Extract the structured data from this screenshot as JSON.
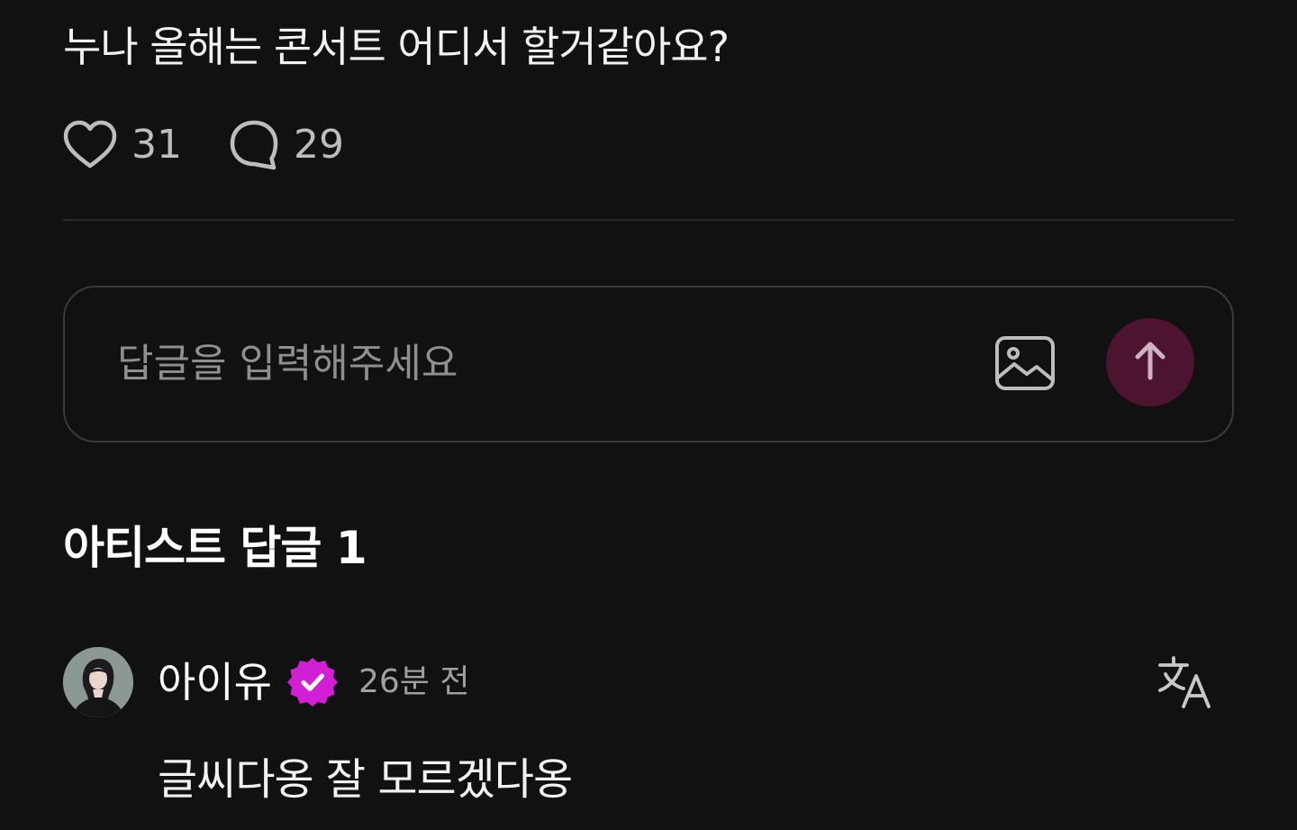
{
  "post": {
    "text": "누나 올해는 콘서트 어디서 할거같아요?",
    "like_count": "31",
    "comment_count": "29"
  },
  "reply_input": {
    "placeholder": "답글을 입력해주세요"
  },
  "artist_replies": {
    "title": "아티스트 답글 1"
  },
  "comment": {
    "author": "아이유",
    "time": "26분 전",
    "text": "글씨다옹 잘 모르겠다옹"
  },
  "colors": {
    "background": "#111111",
    "send_button": "#4d1430",
    "verified_badge": "#d21fd6",
    "muted_text": "#a0a0a0"
  },
  "icons": {
    "like": "heart-icon",
    "comment": "speech-bubble-icon",
    "attach": "image-icon",
    "send": "arrow-up-icon",
    "verified": "verified-badge-icon",
    "translate": "translate-icon"
  }
}
